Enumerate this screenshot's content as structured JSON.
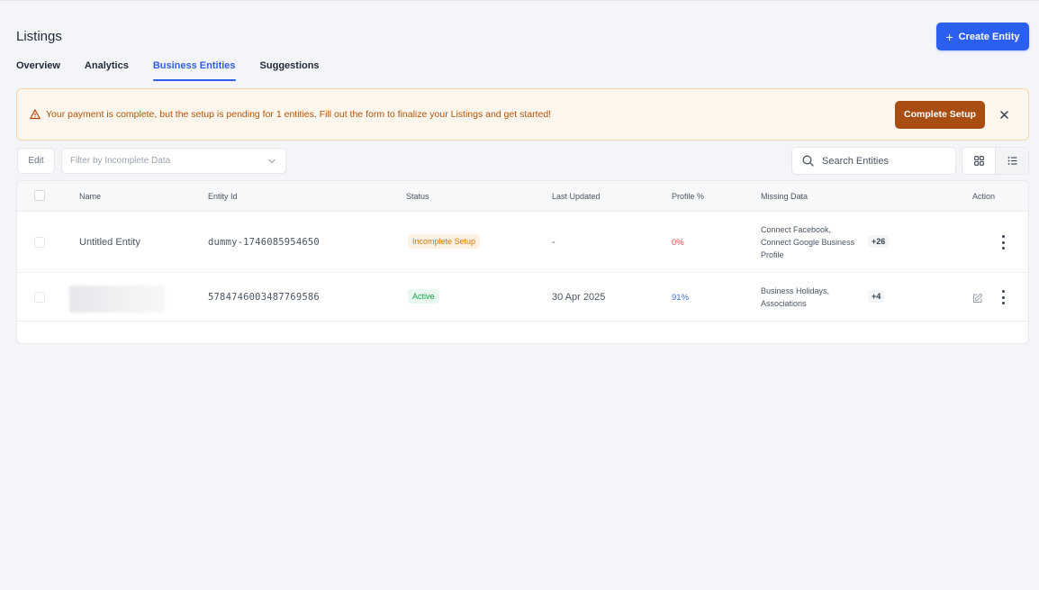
{
  "header": {
    "title": "Listings",
    "create_button": "Create Entity",
    "create_icon": "+"
  },
  "tabs": [
    {
      "label": "Overview",
      "active": false
    },
    {
      "label": "Analytics",
      "active": false
    },
    {
      "label": "Business Entities",
      "active": true
    },
    {
      "label": "Suggestions",
      "active": false
    }
  ],
  "banner": {
    "message": "Your payment is complete, but the setup is pending for 1 entities. Fill out the form to finalize your Listings and get started!",
    "button": "Complete Setup",
    "icon": "warning-triangle-icon"
  },
  "toolbar": {
    "edit_label": "Edit",
    "filter_placeholder": "Filter by Incomplete Data",
    "search_placeholder": "Search Entities"
  },
  "table": {
    "headers": {
      "name": "Name",
      "entity_id": "Entity Id",
      "status": "Status",
      "last_updated": "Last Updated",
      "profile": "Profile %",
      "missing": "Missing Data",
      "action": "Action"
    },
    "rows": [
      {
        "name": "Untitled Entity",
        "entity_id": "dummy-1746085954650",
        "status": "Incomplete Setup",
        "last_updated": "-",
        "profile": "0%",
        "missing_line1": "Connect Facebook,",
        "missing_line2": "Connect Google Business",
        "missing_line3": "Profile",
        "more": "+26"
      },
      {
        "name": "",
        "entity_id": "5784746003487769586",
        "status": "Active",
        "last_updated": "30 Apr 2025",
        "profile": "91%",
        "missing_line1": "Business Holidays,",
        "missing_line2": "Associations",
        "more": "+4"
      }
    ]
  },
  "colors": {
    "primary": "#2b5ff0",
    "warning_bg": "#fdf6ec",
    "warning_text": "#b45309",
    "complete_button": "#a84e12",
    "incomplete": "#d97706",
    "active": "#16a34a",
    "profile_low": "#ef4444",
    "profile_high": "#3b6fe0"
  }
}
